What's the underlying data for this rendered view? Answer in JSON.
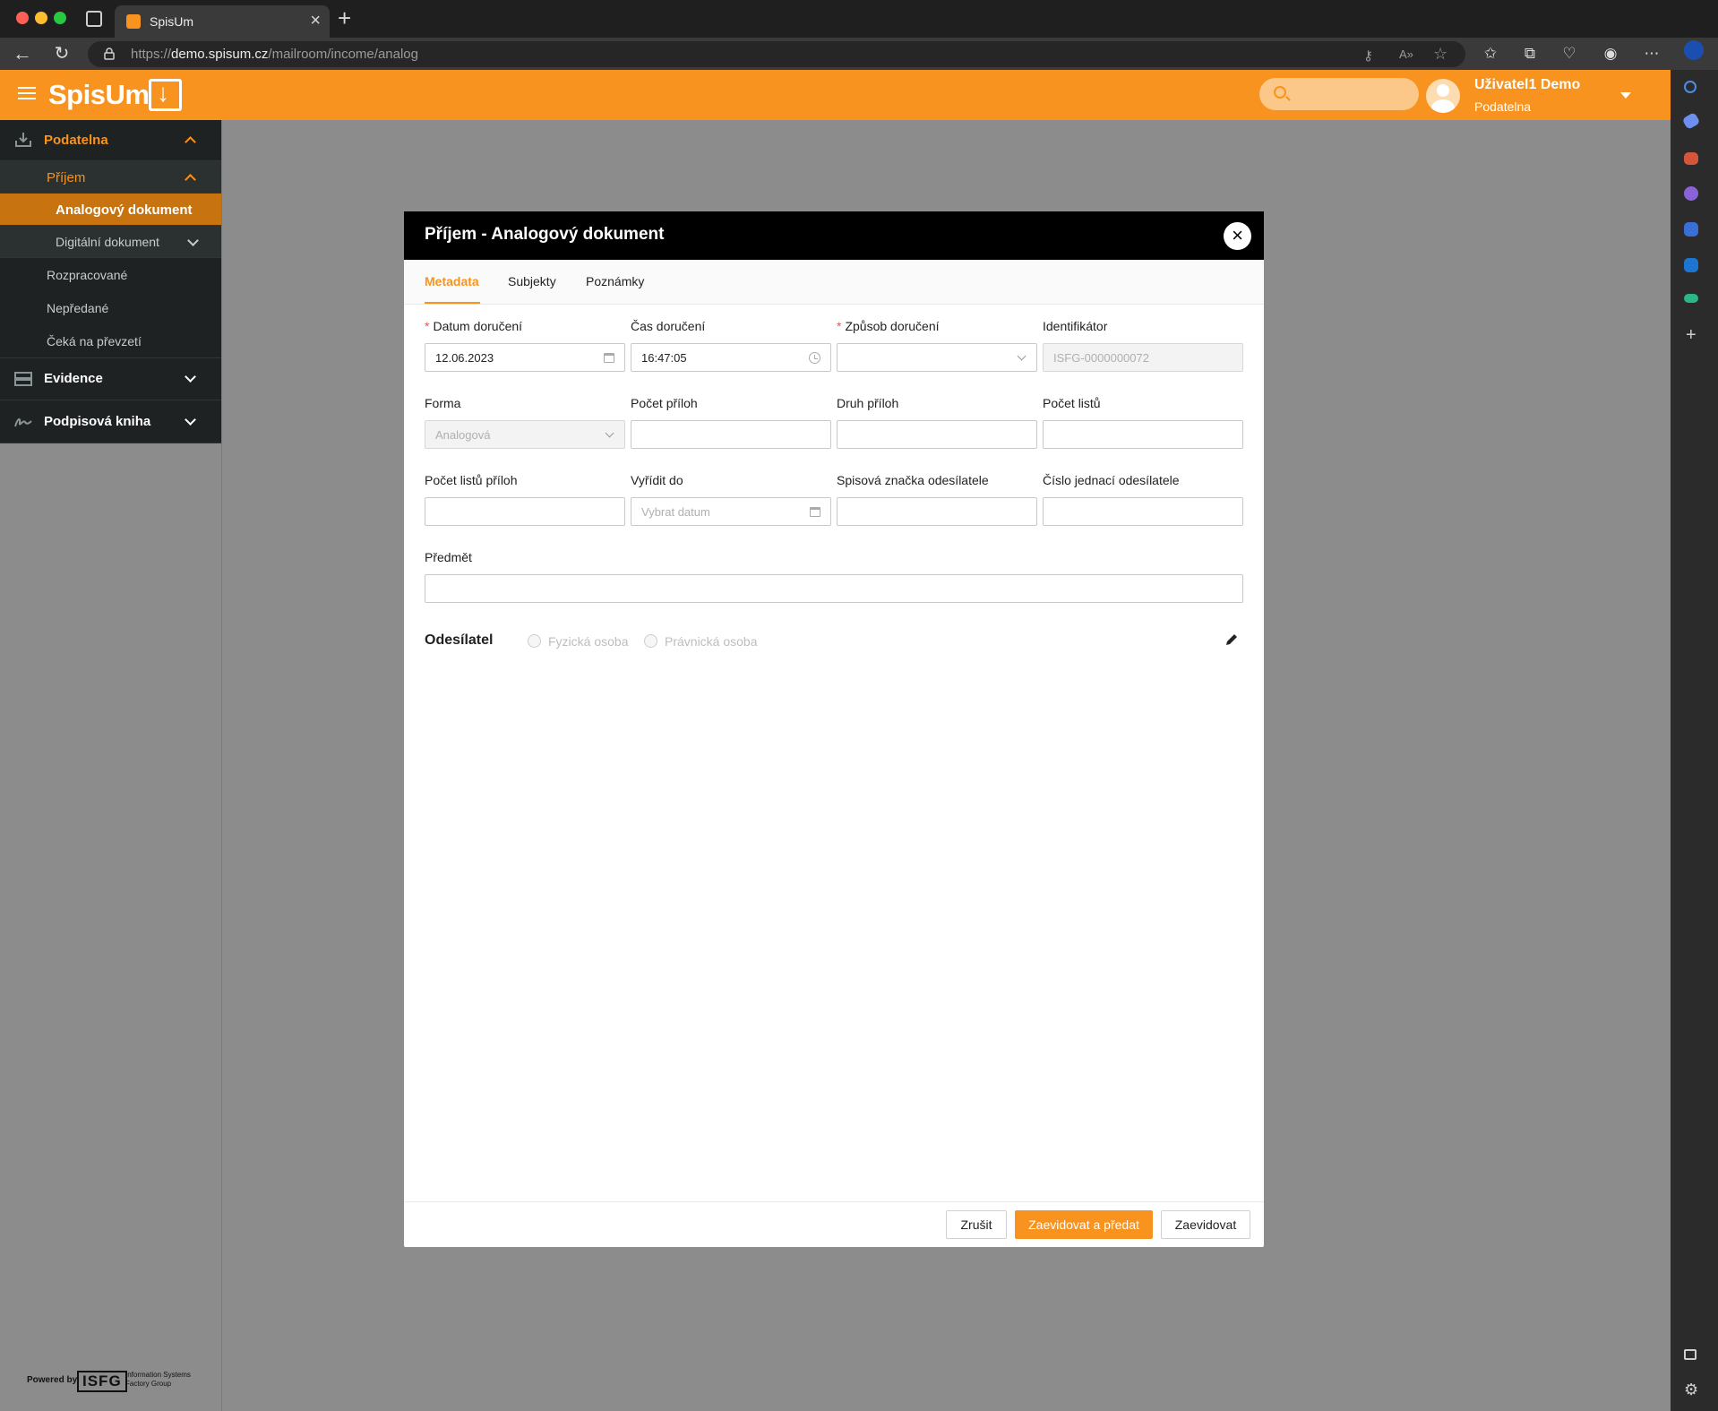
{
  "browser": {
    "tab_title": "SpisUm",
    "url_prefix": "https://",
    "url_host": "demo.spisum.cz",
    "url_path": "/mailroom/income/analog"
  },
  "app": {
    "logo": "SpisUm",
    "user": {
      "name": "Uživatel1 Demo",
      "role": "Podatelna"
    }
  },
  "sidebar": {
    "sections": [
      {
        "label": "Podatelna"
      },
      {
        "label": "Evidence"
      },
      {
        "label": "Podpisová kniha"
      }
    ],
    "podatelna": {
      "group": "Příjem",
      "active_item": "Analogový dokument",
      "digital_item": "Digitální dokument",
      "items": [
        "Rozpracované",
        "Nepředané",
        "Čeká na převzetí"
      ]
    },
    "footer": {
      "powered_by": "Powered by",
      "brand": "ISFG",
      "brand_line1": "Information Systems",
      "brand_line2": "Factory Group"
    }
  },
  "dialog": {
    "title": "Příjem - Analogový dokument",
    "tabs": [
      "Metadata",
      "Subjekty",
      "Poznámky"
    ],
    "fields": {
      "datum_doruceni": {
        "label": "Datum doručení",
        "value": "12.06.2023"
      },
      "cas_doruceni": {
        "label": "Čas doručení",
        "value": "16:47:05"
      },
      "zpusob_doruceni": {
        "label": "Způsob doručení",
        "value": ""
      },
      "identifikator": {
        "label": "Identifikátor",
        "value": "ISFG-0000000072"
      },
      "forma": {
        "label": "Forma",
        "value": "Analogová"
      },
      "pocet_priloh": {
        "label": "Počet příloh",
        "value": ""
      },
      "druh_priloh": {
        "label": "Druh příloh",
        "value": ""
      },
      "pocet_listu": {
        "label": "Počet listů",
        "value": ""
      },
      "pocet_listu_priloh": {
        "label": "Počet listů příloh",
        "value": ""
      },
      "vyridit_do": {
        "label": "Vyřídit do",
        "placeholder": "Vybrat datum"
      },
      "spisova_znacka": {
        "label": "Spisová značka odesílatele",
        "value": ""
      },
      "cislo_jednaci": {
        "label": "Číslo jednací odesílatele",
        "value": ""
      },
      "predmet": {
        "label": "Předmět",
        "value": ""
      }
    },
    "sender": {
      "title": "Odesílatel",
      "options": [
        "Fyzická osoba",
        "Právnická osoba"
      ]
    },
    "buttons": {
      "cancel": "Zrušit",
      "register_and_hand_over": "Zaevidovat a předat",
      "register": "Zaevidovat"
    }
  },
  "colors": {
    "accent": "#f7931e",
    "overlay": "#8c8c8c",
    "sidebar_dark": "#1e2222"
  }
}
